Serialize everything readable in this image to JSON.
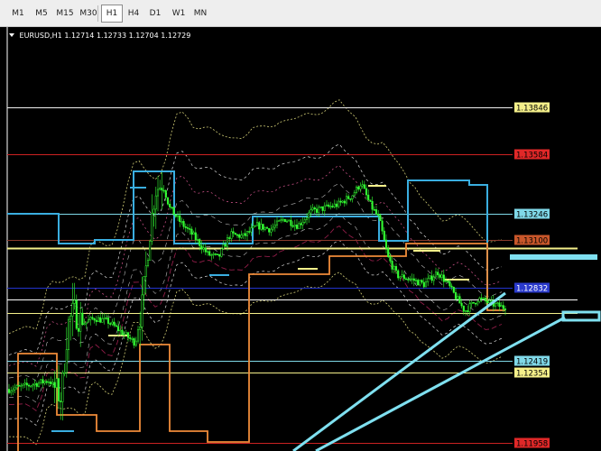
{
  "timeframes": [
    {
      "label": "M1",
      "active": false
    },
    {
      "label": "M5",
      "active": false
    },
    {
      "label": "M15",
      "active": false
    },
    {
      "label": "M30",
      "active": false
    },
    {
      "label": "H1",
      "active": true
    },
    {
      "label": "H4",
      "active": false
    },
    {
      "label": "D1",
      "active": false
    },
    {
      "label": "W1",
      "active": false
    },
    {
      "label": "MN",
      "active": false
    }
  ],
  "chart": {
    "symbol": "EURUSD,H1",
    "open": "1.12714",
    "high": "1.12733",
    "low": "1.12704",
    "close": "1.12729",
    "background": "#000000",
    "candle_color": "#33ff33"
  },
  "price_levels": [
    {
      "label": "1.13846",
      "price": 1.13846,
      "line_color": "#f0f0f0",
      "label_bg": "#f5f08a",
      "label_fg": "#000000"
    },
    {
      "label": "1.13584",
      "price": 1.13584,
      "line_color": "#cc2222",
      "label_bg": "#e02828",
      "label_fg": "#000000"
    },
    {
      "label": "1.13246",
      "price": 1.13246,
      "line_color": "#7fd8e8",
      "label_bg": "#7fd8e8",
      "label_fg": "#000000"
    },
    {
      "label": "1.13100",
      "price": 1.131,
      "line_color": "#8a3a2a",
      "label_bg": "#c8562a",
      "label_fg": "#000000"
    },
    {
      "label": "1.12832",
      "price": 1.12832,
      "line_color": "#2233cc",
      "label_bg": "#2a3acc",
      "label_fg": "#ffffff"
    },
    {
      "label": "1.12419",
      "price": 1.12419,
      "line_color": "#7fd8e8",
      "label_bg": "#7fd8e8",
      "label_fg": "#000000"
    },
    {
      "label": "1.12354",
      "price": 1.12354,
      "line_color": "#f5f08a",
      "label_bg": "#f5f08a",
      "label_fg": "#000000"
    },
    {
      "label": "1.11958",
      "price": 1.11958,
      "line_color": "#cc2222",
      "label_bg": "#e02828",
      "label_fg": "#000000"
    }
  ],
  "extra_lines": [
    {
      "price": 1.13055,
      "color": "#f5f08a"
    },
    {
      "price": 1.12765,
      "color": "#ffffff"
    },
    {
      "price": 1.12688,
      "color": "#f5f08a"
    }
  ],
  "arrows": {
    "color": "#7fe0f0"
  }
}
